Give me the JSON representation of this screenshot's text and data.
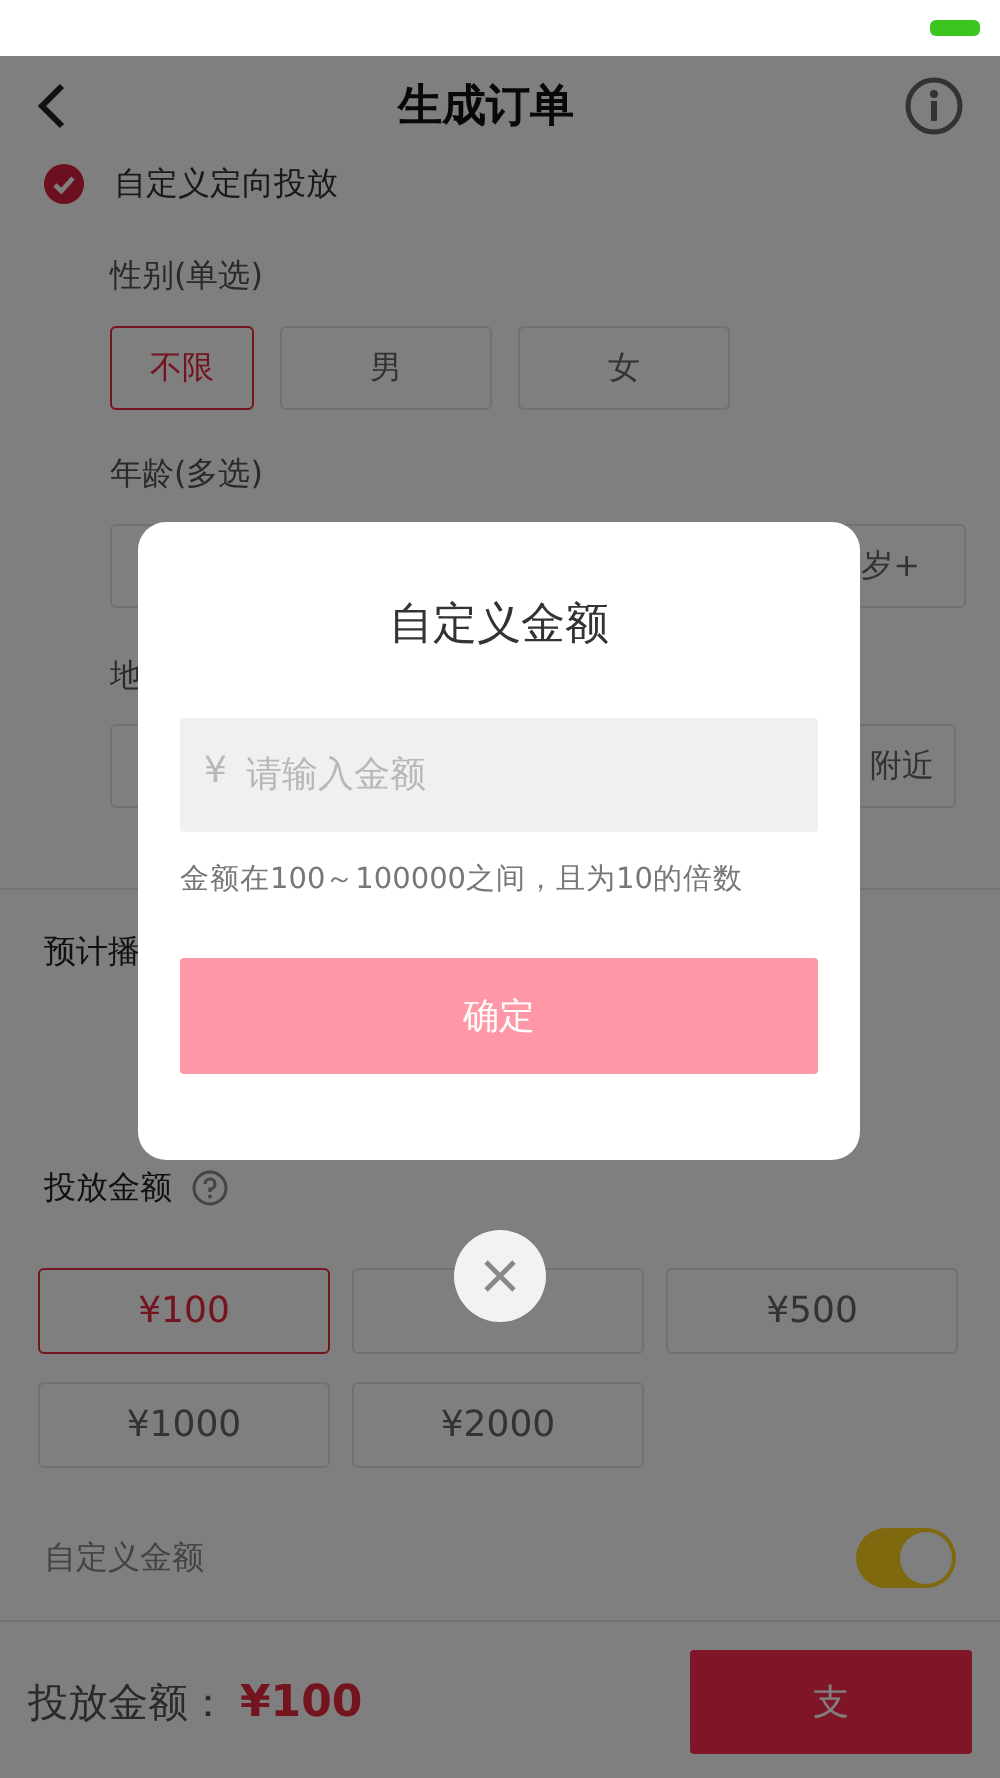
{
  "nav": {
    "title": "生成订单"
  },
  "targeting": {
    "label": "自定义定向投放",
    "checked": true
  },
  "gender": {
    "label": "性别(单选)",
    "options": [
      {
        "label": "不限",
        "selected": true
      },
      {
        "label": "男",
        "selected": false
      },
      {
        "label": "女",
        "selected": false
      }
    ]
  },
  "age": {
    "label": "年龄(多选)",
    "options": [
      {
        "label": "岁+",
        "selected": false
      }
    ]
  },
  "region": {
    "label": "地",
    "options": [
      {
        "label": "附近",
        "selected": false
      }
    ]
  },
  "estimate": {
    "label": "预计播"
  },
  "amount": {
    "label": "投放金额",
    "options": [
      {
        "label": "¥100",
        "selected": true
      },
      {
        "selected": false
      },
      {
        "label": "¥500",
        "selected": false
      },
      {
        "label": "¥1000",
        "selected": false
      },
      {
        "label": "¥2000",
        "selected": false
      }
    ],
    "custom": {
      "label": "自定义金额",
      "on": true
    }
  },
  "footer": {
    "label": "投放金额：",
    "total": "¥100",
    "button": "支"
  },
  "dialog": {
    "title": "自定义金额",
    "currency": "¥",
    "placeholder": "请输入金额",
    "hint": "金额在100～100000之间，且为10的倍数",
    "confirm": "确定"
  }
}
